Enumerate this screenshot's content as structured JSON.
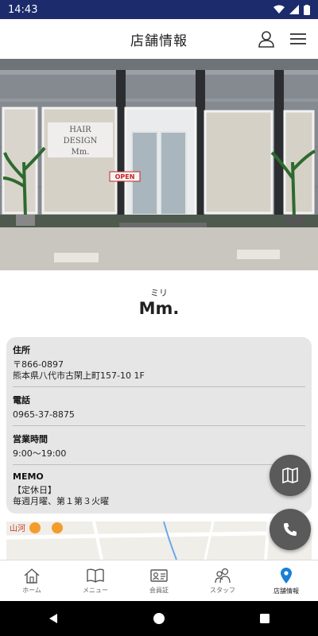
{
  "status_bar": {
    "time": "14:43"
  },
  "header": {
    "title": "店舗情報"
  },
  "hero": {
    "sign_line1": "HAIR",
    "sign_line2": "DESIGN",
    "sign_line3": "Mm.",
    "open_sign": "OPEN"
  },
  "shop": {
    "ruby": "ミリ",
    "name": "Mm."
  },
  "info": [
    {
      "label": "住所",
      "lines": [
        "〒866-0897",
        "熊本県八代市古閑上町157-10 1F"
      ]
    },
    {
      "label": "電話",
      "lines": [
        "0965-37-8875"
      ]
    },
    {
      "label": "営業時間",
      "lines": [
        "9:00〜19:00"
      ]
    },
    {
      "label": "MEMO",
      "lines": [
        "【定休日】",
        "毎週月曜、第１第３火曜"
      ]
    }
  ],
  "map": {
    "label": "山河"
  },
  "bottom_nav": [
    {
      "label": "ホーム",
      "icon": "home-icon"
    },
    {
      "label": "メニュー",
      "icon": "book-icon"
    },
    {
      "label": "会員証",
      "icon": "member-card-icon"
    },
    {
      "label": "スタッフ",
      "icon": "staff-icon"
    },
    {
      "label": "店舗情報",
      "icon": "location-pin-icon",
      "active": true
    }
  ],
  "colors": {
    "status_bar": "#1b2b6b",
    "accent": "#1a7fd6",
    "fab": "#5a5a5a",
    "card": "#e6e6e6"
  }
}
